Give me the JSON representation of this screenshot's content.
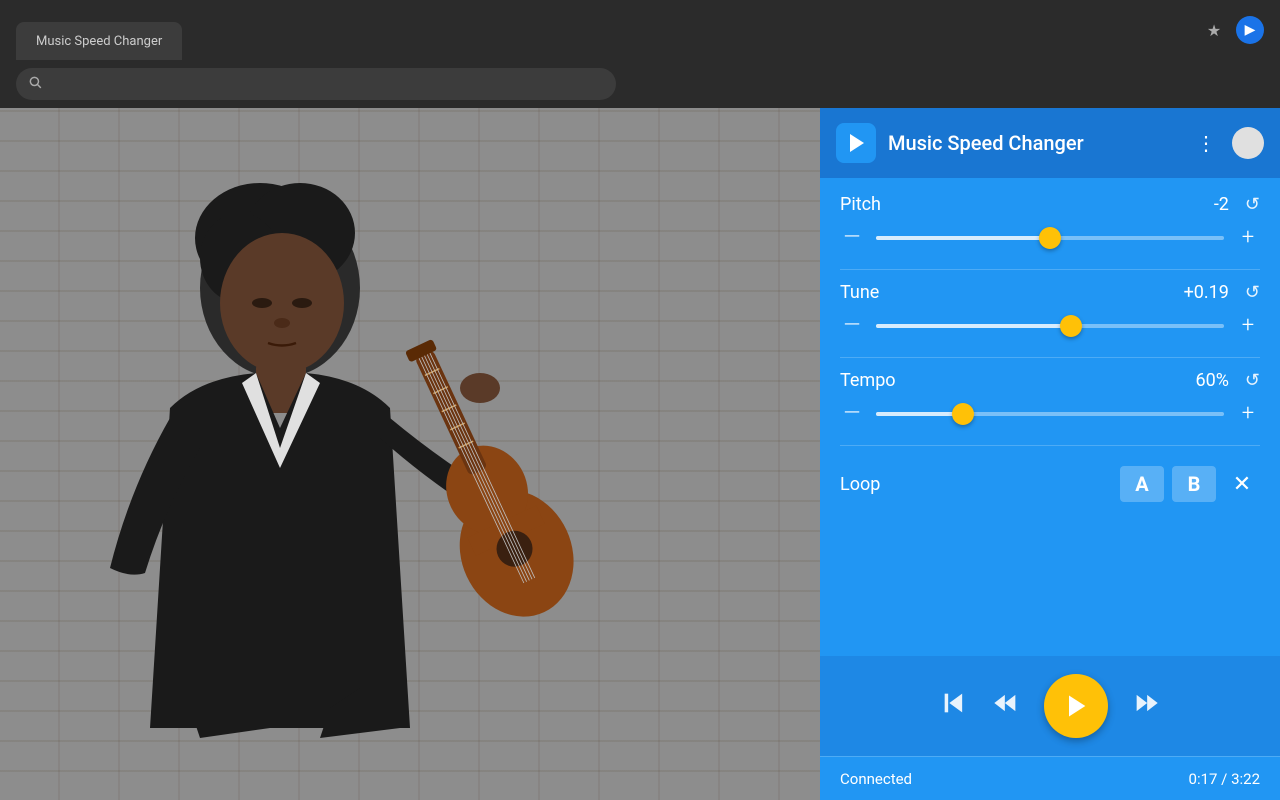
{
  "browser": {
    "tab_label": "Music Speed Changer",
    "star_icon": "★",
    "extension_icon": "▶"
  },
  "header": {
    "logo_icon": "▶",
    "title": "Music Speed Changer",
    "menu_icon": "⋮"
  },
  "controls": {
    "pitch": {
      "label": "Pitch",
      "value": "-2",
      "reset_icon": "↺",
      "minus": "—",
      "plus": "+",
      "thumb_position_pct": 50,
      "fill_pct": 50
    },
    "tune": {
      "label": "Tune",
      "value": "+0.19",
      "reset_icon": "↺",
      "minus": "—",
      "plus": "+",
      "thumb_position_pct": 56,
      "fill_pct": 56
    },
    "tempo": {
      "label": "Tempo",
      "value": "60%",
      "reset_icon": "↺",
      "minus": "—",
      "plus": "+",
      "thumb_position_pct": 25,
      "fill_pct": 25
    }
  },
  "loop": {
    "label": "Loop",
    "btn_a": "A",
    "btn_b": "B",
    "close": "✕"
  },
  "playback": {
    "skip_back_icon": "⏮",
    "rewind_icon": "⏪",
    "play_icon": "▶",
    "fast_forward_icon": "⏩"
  },
  "status": {
    "connected": "Connected",
    "time": "0:17 / 3:22"
  }
}
